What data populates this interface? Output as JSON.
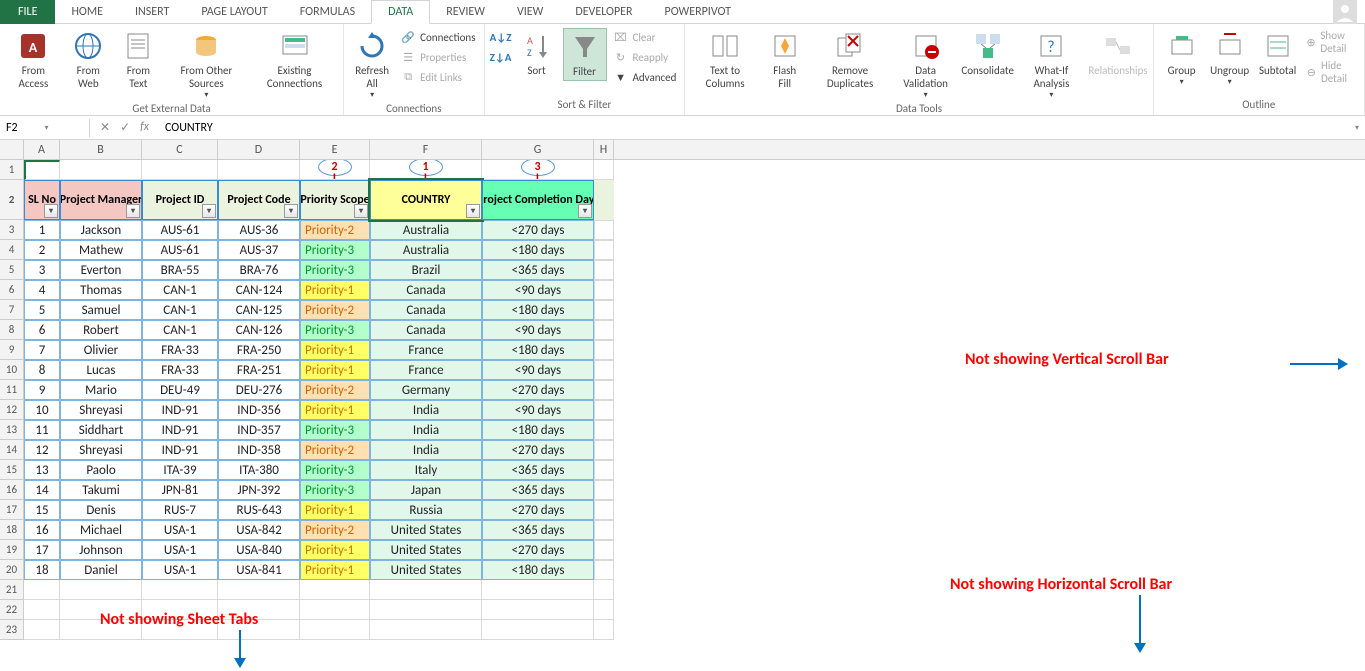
{
  "tabs": {
    "file": "FILE",
    "home": "HOME",
    "insert": "INSERT",
    "page_layout": "PAGE LAYOUT",
    "formulas": "FORMULAS",
    "data": "DATA",
    "review": "REVIEW",
    "view": "VIEW",
    "developer": "DEVELOPER",
    "powerpivot": "POWERPIVOT"
  },
  "ribbon": {
    "get_external": {
      "access": "From Access",
      "web": "From Web",
      "text": "From Text",
      "other": "From Other Sources",
      "existing": "Existing Connections",
      "label": "Get External Data"
    },
    "connections": {
      "refresh": "Refresh All",
      "connections": "Connections",
      "properties": "Properties",
      "edit_links": "Edit Links",
      "label": "Connections"
    },
    "sort_filter": {
      "sort": "Sort",
      "filter": "Filter",
      "clear": "Clear",
      "reapply": "Reapply",
      "advanced": "Advanced",
      "label": "Sort & Filter"
    },
    "data_tools": {
      "text_cols": "Text to Columns",
      "flash": "Flash Fill",
      "dup": "Remove Duplicates",
      "valid": "Data Validation",
      "consol": "Consolidate",
      "whatif": "What-If Analysis",
      "rel": "Relationships",
      "label": "Data Tools"
    },
    "outline": {
      "group": "Group",
      "ungroup": "Ungroup",
      "subtotal": "Subtotal",
      "show": "Show Detail",
      "hide": "Hide Detail",
      "label": "Outline"
    }
  },
  "name_box": "F2",
  "formula": "COUNTRY",
  "cols": [
    "A",
    "B",
    "C",
    "D",
    "E",
    "F",
    "G",
    "H"
  ],
  "anno_nums": {
    "e": "2",
    "f": "1",
    "g": "3"
  },
  "headers": {
    "sl": "SL No",
    "pm": "Project Manager",
    "pid": "Project ID",
    "pcode": "Project Code",
    "scope": "Priority Scope",
    "country": "COUNTRY",
    "comp": "Project Completion Days"
  },
  "rows": [
    {
      "n": "1",
      "pm": "Jackson",
      "pid": "AUS-61",
      "code": "AUS-36",
      "pri": "Priority-2",
      "pc": "pri2",
      "country": "Australia",
      "days": "<270 days"
    },
    {
      "n": "2",
      "pm": "Mathew",
      "pid": "AUS-61",
      "code": "AUS-37",
      "pri": "Priority-3",
      "pc": "pri3",
      "country": "Australia",
      "days": "<180 days"
    },
    {
      "n": "3",
      "pm": "Everton",
      "pid": "BRA-55",
      "code": "BRA-76",
      "pri": "Priority-3",
      "pc": "pri3",
      "country": "Brazil",
      "days": "<365 days"
    },
    {
      "n": "4",
      "pm": "Thomas",
      "pid": "CAN-1",
      "code": "CAN-124",
      "pri": "Priority-1",
      "pc": "pri1",
      "country": "Canada",
      "days": "<90 days"
    },
    {
      "n": "5",
      "pm": "Samuel",
      "pid": "CAN-1",
      "code": "CAN-125",
      "pri": "Priority-2",
      "pc": "pri2",
      "country": "Canada",
      "days": "<180 days"
    },
    {
      "n": "6",
      "pm": "Robert",
      "pid": "CAN-1",
      "code": "CAN-126",
      "pri": "Priority-3",
      "pc": "pri3",
      "country": "Canada",
      "days": "<90 days"
    },
    {
      "n": "7",
      "pm": "Olivier",
      "pid": "FRA-33",
      "code": "FRA-250",
      "pri": "Priority-1",
      "pc": "pri1",
      "country": "France",
      "days": "<180 days"
    },
    {
      "n": "8",
      "pm": "Lucas",
      "pid": "FRA-33",
      "code": "FRA-251",
      "pri": "Priority-1",
      "pc": "pri1",
      "country": "France",
      "days": "<90 days"
    },
    {
      "n": "9",
      "pm": "Mario",
      "pid": "DEU-49",
      "code": "DEU-276",
      "pri": "Priority-2",
      "pc": "pri2",
      "country": "Germany",
      "days": "<270 days"
    },
    {
      "n": "10",
      "pm": "Shreyasi",
      "pid": "IND-91",
      "code": "IND-356",
      "pri": "Priority-1",
      "pc": "pri1",
      "country": "India",
      "days": "<90 days"
    },
    {
      "n": "11",
      "pm": "Siddhart",
      "pid": "IND-91",
      "code": "IND-357",
      "pri": "Priority-3",
      "pc": "pri3",
      "country": "India",
      "days": "<180 days"
    },
    {
      "n": "12",
      "pm": "Shreyasi",
      "pid": "IND-91",
      "code": "IND-358",
      "pri": "Priority-2",
      "pc": "pri2",
      "country": "India",
      "days": "<270 days"
    },
    {
      "n": "13",
      "pm": "Paolo",
      "pid": "ITA-39",
      "code": "ITA-380",
      "pri": "Priority-3",
      "pc": "pri3",
      "country": "Italy",
      "days": "<365 days"
    },
    {
      "n": "14",
      "pm": "Takumi",
      "pid": "JPN-81",
      "code": "JPN-392",
      "pri": "Priority-3",
      "pc": "pri3",
      "country": "Japan",
      "days": "<365 days"
    },
    {
      "n": "15",
      "pm": "Denis",
      "pid": "RUS-7",
      "code": "RUS-643",
      "pri": "Priority-1",
      "pc": "pri1",
      "country": "Russia",
      "days": "<270 days"
    },
    {
      "n": "16",
      "pm": "Michael",
      "pid": "USA-1",
      "code": "USA-842",
      "pri": "Priority-2",
      "pc": "pri2",
      "country": "United States",
      "days": "<365 days"
    },
    {
      "n": "17",
      "pm": "Johnson",
      "pid": "USA-1",
      "code": "USA-840",
      "pri": "Priority-1",
      "pc": "pri1",
      "country": "United States",
      "days": "<270 days"
    },
    {
      "n": "18",
      "pm": "Daniel",
      "pid": "USA-1",
      "code": "USA-841",
      "pri": "Priority-1",
      "pc": "pri1",
      "country": "United States",
      "days": "<180 days"
    }
  ],
  "annotations": {
    "tabs": "Not showing Sheet Tabs",
    "vscroll": "Not showing Vertical Scroll Bar",
    "hscroll": "Not showing Horizontal Scroll Bar"
  }
}
